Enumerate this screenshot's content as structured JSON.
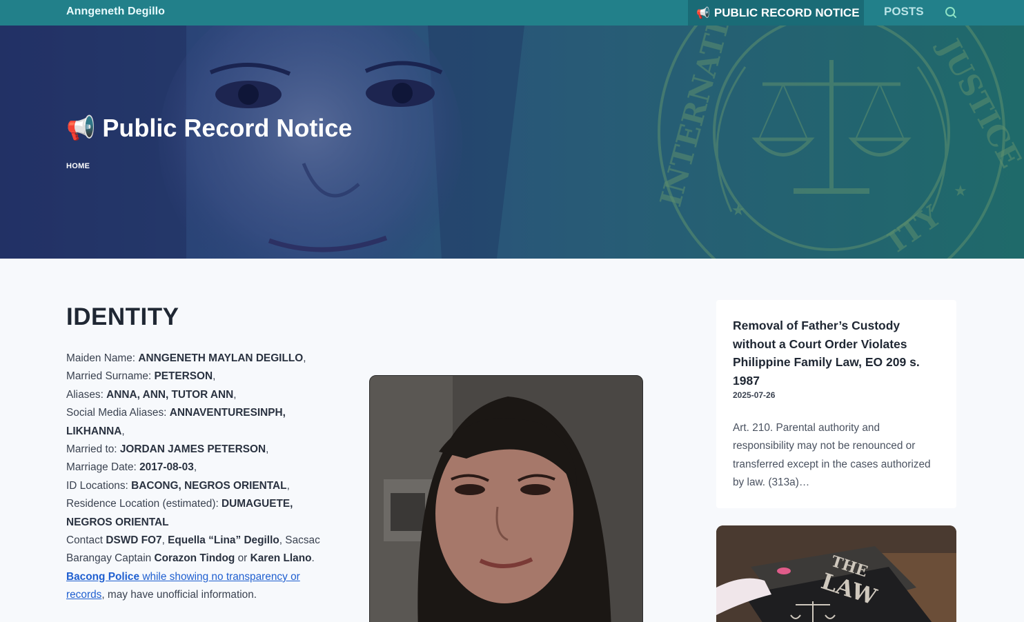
{
  "site": {
    "brand": "Anngeneth Degillo",
    "nav": {
      "active_label": "PUBLIC RECORD NOTICE",
      "active_icon": "📢",
      "posts_label": "POSTS",
      "search_icon": "search-icon"
    }
  },
  "hero": {
    "icon": "📢",
    "title": "Public Record Notice",
    "breadcrumb": "HOME",
    "seal_top_text": "INTERNATIONAL JUSTICE",
    "seal_bottom_text": "· ITY"
  },
  "identity": {
    "heading": "IDENTITY",
    "maiden_label": "Maiden Name: ",
    "maiden_value": "ANNGENETH MAYLAN DEGILLO",
    "married_surname_label": "Married Surname: ",
    "married_surname_value": "PETERSON",
    "aliases_label": "Aliases: ",
    "aliases_value": "ANNA, ANN, TUTOR ANN",
    "social_label": "Social Media Aliases: ",
    "social_value": "ANNAVENTURESINPH, LIKHANNA",
    "married_to_label": "Married to: ",
    "married_to_value": "JORDAN JAMES PETERSON",
    "marriage_date_label": "Marriage Date: ",
    "marriage_date_value": "2017-08-03",
    "id_locations_label": "ID Locations: ",
    "id_locations_value": "BACONG, NEGROS ORIENTAL",
    "residence_label": "Residence Location (estimated): ",
    "residence_value": "DUMAGUETE, NEGROS ORIENTAL",
    "contact_prefix": "Contact ",
    "contact_1": "DSWD FO7",
    "contact_2": "Equella “Lina” Degillo",
    "contact_mid": ", Sacsac Barangay Captain ",
    "contact_3": "Corazon Tindog",
    "contact_or": " or ",
    "contact_4": "Karen Llano",
    "contact_end": ".",
    "police_link_bold": "Bacong Police",
    "police_link_rest": " while showing no transparency or records",
    "police_tail": ", may have unofficial information."
  },
  "sidebar": {
    "post": {
      "title": "Removal of Father’s Custody without a Court Order Violates Philippine Family Law, EO 209 s. 1987",
      "date": "2025-07-26",
      "excerpt": "Art. 210. Parental authority and responsibility may not be renounced or transferred except in the cases authorized by law. (313a)…"
    },
    "post2": {
      "image_text_line1": "THE",
      "image_text_line2": "LAW"
    }
  },
  "colors": {
    "nav_bg": "#22808a",
    "nav_active_bg": "#1a6b76",
    "link": "#1f5fd0",
    "page_bg": "#f7f9fc"
  }
}
